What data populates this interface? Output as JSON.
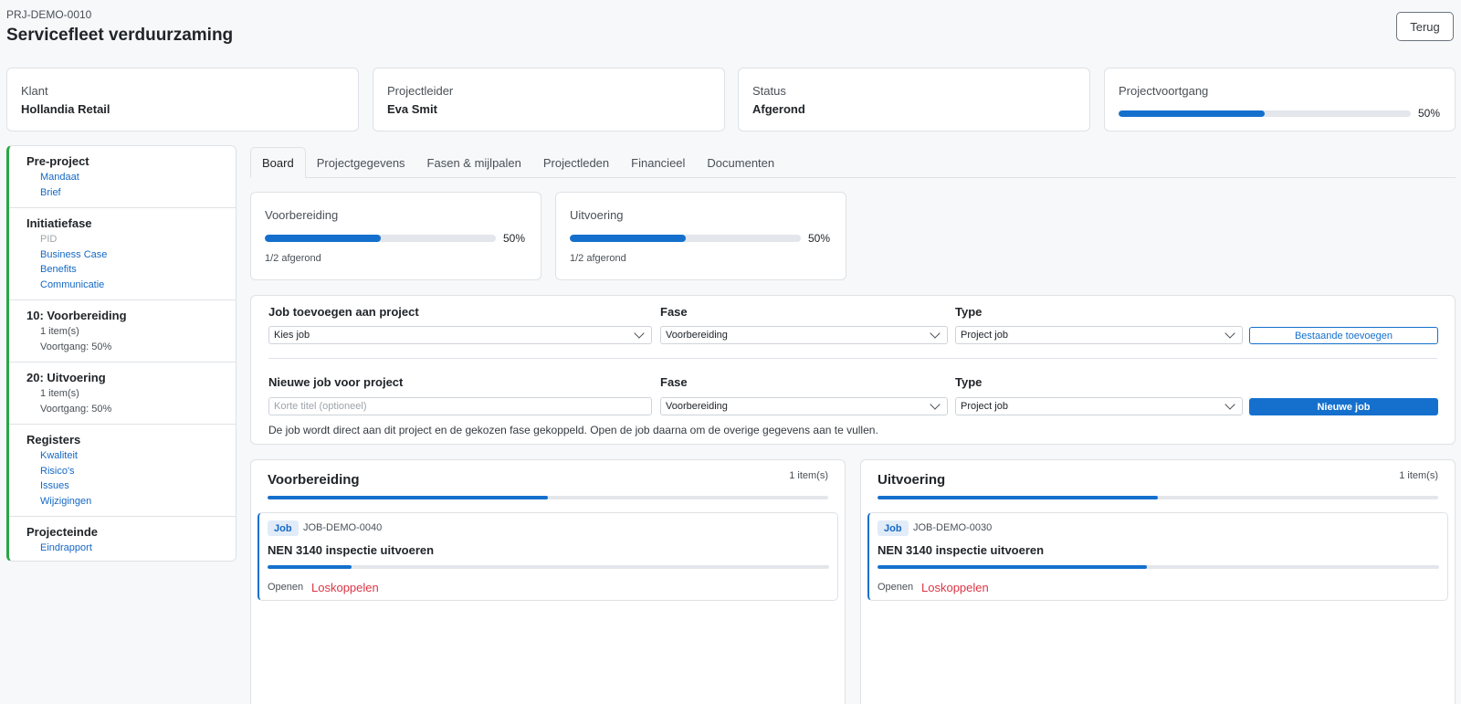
{
  "header": {
    "code": "PRJ-DEMO-0010",
    "title": "Servicefleet verduurzaming",
    "back_label": "Terug"
  },
  "info": {
    "client_label": "Klant",
    "client_value": "Hollandia Retail",
    "lead_label": "Projectleider",
    "lead_value": "Eva Smit",
    "status_label": "Status",
    "status_value": "Afgerond",
    "progress_label": "Projectvoortgang",
    "progress_text": "50%",
    "progress_value": 0.5
  },
  "sidebar": {
    "sections": [
      {
        "title": "Pre-project",
        "links": [
          "Mandaat",
          "Brief"
        ]
      },
      {
        "title": "Initiatiefase",
        "muted": "PID",
        "links": [
          "Business Case",
          "Benefits",
          "Communicatie"
        ]
      },
      {
        "title": "10: Voorbereiding",
        "meta": [
          "1 item(s)",
          "Voortgang: 50%"
        ]
      },
      {
        "title": "20: Uitvoering",
        "meta": [
          "1 item(s)",
          "Voortgang: 50%"
        ]
      },
      {
        "title": "Registers",
        "links": [
          "Kwaliteit",
          "Risico's",
          "Issues",
          "Wijzigingen"
        ]
      },
      {
        "title": "Projecteinde",
        "links": [
          "Eindrapport"
        ]
      }
    ]
  },
  "tabs": [
    "Board",
    "Projectgegevens",
    "Fasen & mijlpalen",
    "Projectleden",
    "Financieel",
    "Documenten"
  ],
  "phases": [
    {
      "name": "Voorbereiding",
      "pct_text": "50%",
      "value": 0.5,
      "sub": "1/2 afgerond"
    },
    {
      "name": "Uitvoering",
      "pct_text": "50%",
      "value": 0.5,
      "sub": "1/2 afgerond"
    }
  ],
  "job_form": {
    "add_label": "Job toevoegen aan project",
    "phase_label": "Fase",
    "type_label": "Type",
    "select_job": "Kies job",
    "phase_value": "Voorbereiding",
    "type_value": "Project job",
    "add_existing_button": "Bestaande toevoegen",
    "new_label": "Nieuwe job voor project",
    "title_placeholder": "Korte titel (optioneel)",
    "new_phase_value": "Voorbereiding",
    "new_type_value": "Project job",
    "new_job_button": "Nieuwe job",
    "help": "De job wordt direct aan dit project en de gekozen fase gekoppeld. Open de job daarna om de overige gegevens aan te vullen."
  },
  "board": {
    "columns": [
      {
        "title": "Voorbereiding",
        "count": "1 item(s)",
        "progress": 0.5,
        "job": {
          "badge": "Job",
          "code": "JOB-DEMO-0040",
          "title": "NEN 3140 inspectie uitvoeren",
          "progress": 0.15,
          "open": "Openen",
          "unlink": "Loskoppelen"
        }
      },
      {
        "title": "Uitvoering",
        "count": "1 item(s)",
        "progress": 0.5,
        "job": {
          "badge": "Job",
          "code": "JOB-DEMO-0030",
          "title": "NEN 3140 inspectie uitvoeren",
          "progress": 0.48,
          "open": "Openen",
          "unlink": "Loskoppelen"
        }
      }
    ]
  },
  "colors": {
    "accent": "#1570cd",
    "danger": "#dc3545",
    "phase_border": "#28a745"
  }
}
